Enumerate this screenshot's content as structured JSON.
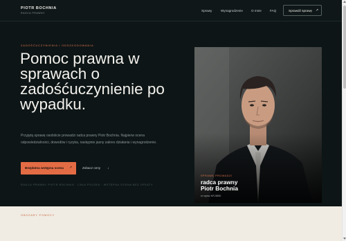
{
  "brand": {
    "name": "PIOTR BOCHNIA",
    "subtitle": "RADCA PRAWNY"
  },
  "nav": {
    "links": [
      "Sprawy",
      "Wynagrodzenie",
      "O mnie",
      "FAQ"
    ],
    "cta": {
      "label": "Sprawdź sprawę",
      "arrow": "↗"
    }
  },
  "hero": {
    "eyebrow": "ZADOŚĆUCZYNIENIA I ODSZKODOWANIA",
    "title": "Pomoc prawna w sprawach o zadośćuczynienie po wypadku.",
    "intro": "Przyjętą sprawę osobiście prowadzi radca prawny Piotr Bochnia. Najpierw ocena odpowiedzialności, dowodów i ryzyka, następnie jasny zakres działania i wynagrodzenie.",
    "primary_button": {
      "label": "Bezpłatna wstępna ocena",
      "arrow": "↗"
    },
    "secondary_button": {
      "label": "Zobacz ceny",
      "arrow": "↓"
    },
    "meta": "RADCA PRAWNY PIOTR BOCHNIA · CAŁA POLSKA · WSTĘPNA OCENA BEZ OPŁATY"
  },
  "portrait": {
    "eyebrow": "SPRAWĘ PROWADZI",
    "role": "radca prawny",
    "name": "Piotr Bochnia",
    "small": "nr wpisu KR-5850"
  },
  "section2": {
    "eyebrow": "OBSZARY POMOCY"
  },
  "colors": {
    "accent": "#e36c45",
    "dark_bg": "#0d1516",
    "light_bg": "#f0ece4"
  },
  "icons": [
    "arrow-up-right-icon",
    "arrow-down-icon"
  ]
}
